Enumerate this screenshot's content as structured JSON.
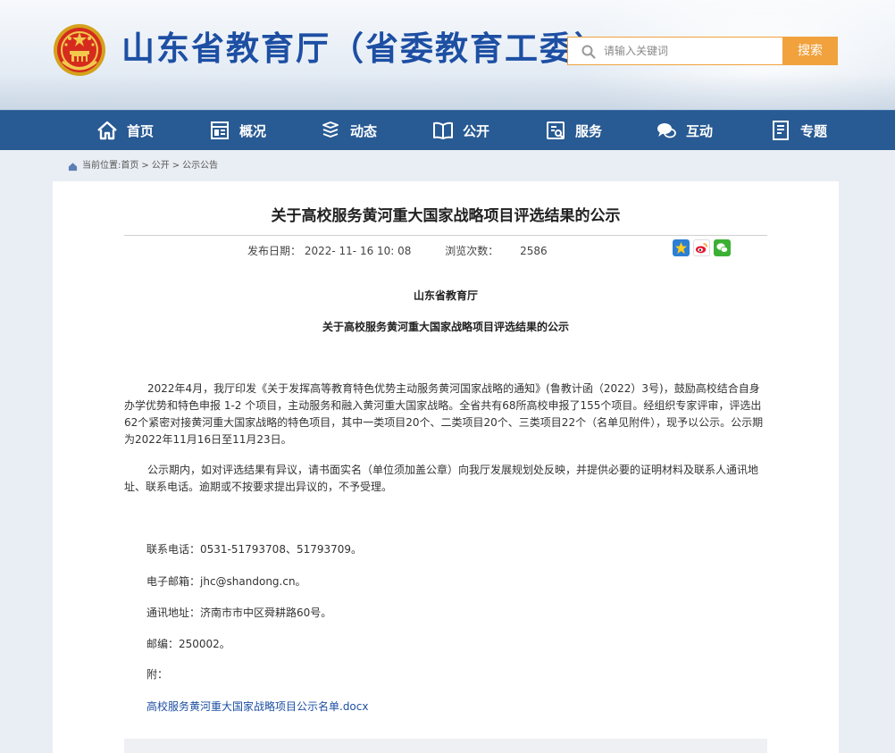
{
  "header": {
    "site_title": "山东省教育厅（省委教育工委）",
    "search_placeholder": "请输入关键词",
    "search_button": "搜索"
  },
  "nav": {
    "items": [
      {
        "label": "首页",
        "icon": "home-icon"
      },
      {
        "label": "概况",
        "icon": "overview-icon"
      },
      {
        "label": "动态",
        "icon": "news-icon"
      },
      {
        "label": "公开",
        "icon": "book-icon"
      },
      {
        "label": "服务",
        "icon": "service-icon"
      },
      {
        "label": "互动",
        "icon": "chat-icon"
      },
      {
        "label": "专题",
        "icon": "topic-icon"
      }
    ]
  },
  "breadcrumb": {
    "prefix": "当前位置:",
    "items": [
      "首页",
      "公开",
      "公示公告"
    ],
    "separator": ">"
  },
  "article": {
    "title": "关于高校服务黄河重大国家战略项目评选结果的公示",
    "publish_label": "发布日期：",
    "publish_date": "2022- 11- 16 10: 08",
    "views_label": "浏览次数：",
    "views": "2586",
    "share_icons": [
      "qzone-star-icon",
      "weibo-icon",
      "wechat-icon"
    ],
    "issuer": "山东省教育厅",
    "subtitle": "关于高校服务黄河重大国家战略项目评选结果的公示",
    "paragraphs": [
      "2022年4月，我厅印发《关于发挥高等教育特色优势主动服务黄河国家战略的通知》(鲁教计函（2022）3号)，鼓励高校结合自身办学优势和特色申报  1-2 个项目，主动服务和融入黄河重大国家战略。全省共有68所高校申报了155个项目。经组织专家评审，评选出62个紧密对接黄河重大国家战略的特色项目，其中一类项目20个、二类项目20个、三类项目22个（名单见附件），现予以公示。公示期为2022年11月16日至11月23日。",
      "公示期内，如对评选结果有异议，请书面实名（单位须加盖公章）向我厅发展规划处反映，并提供必要的证明材料及联系人通讯地址、联系电话。逾期或不按要求提出异议的，不予受理。"
    ],
    "contacts": {
      "phone": "联系电话：0531-51793708、51793709。",
      "email": "电子邮箱：jhc@shandong.cn。",
      "address": "通讯地址：济南市市中区舜耕路60号。",
      "postcode": "邮编：250002。",
      "attachment_label": "附："
    },
    "attachment_link": "高校服务黄河重大国家战略项目公示名单.docx"
  },
  "colors": {
    "nav_bg": "#285a93",
    "title_blue": "#1d4fa3",
    "search_orange": "#f1a23d",
    "page_bg": "#e9eef4"
  }
}
